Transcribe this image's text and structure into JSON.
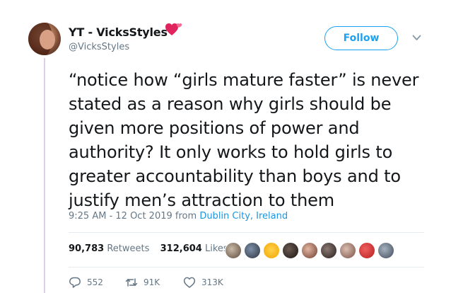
{
  "user": {
    "display_name": "YT - VicksStyles",
    "handle": "@VicksStyles"
  },
  "follow_label": "Follow",
  "tweet": {
    "text": "“notice how “girls mature faster” is never\nstated as a reason why girls should be\ngiven more positions of power and\nauthority? It only works to hold girls to\ngreater accountability than boys and to\njustify men’s attraction to them",
    "time": "9:25 AM - 12 Oct 2019",
    "from_label": "from",
    "location": "Dublin City, Ireland"
  },
  "stats": {
    "retweets_count": "90,783",
    "retweets_label": "Retweets",
    "likes_count": "312,604",
    "likes_label": "Likes"
  },
  "actions": {
    "replies": "552",
    "retweets": "91K",
    "likes": "313K"
  },
  "icons": [
    "heart-emoji-icon",
    "chevron-down-icon",
    "reply-icon",
    "retweet-icon",
    "like-icon"
  ],
  "colors": {
    "accent": "#1da1f2",
    "link": "#1b95e0",
    "secondary_text": "#657786",
    "heart_emoji": "#e0245e",
    "thread_line": "#ddd0e6"
  }
}
